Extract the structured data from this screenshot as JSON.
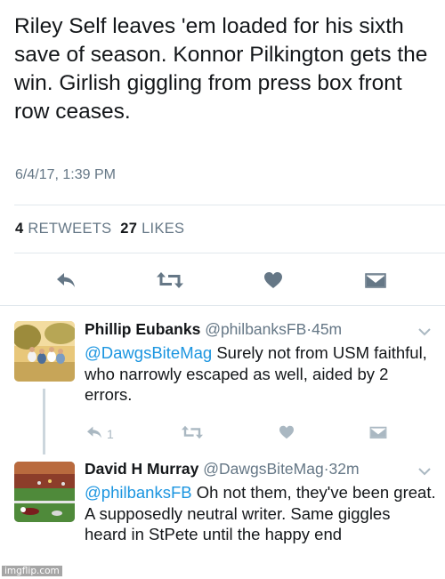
{
  "main_tweet": {
    "text": "Riley Self leaves 'em loaded for his sixth save of season. Konnor Pilkington gets the win. Girlish giggling from press box front row ceases.",
    "timestamp": "6/4/17, 1:39 PM",
    "retweets_count": "4",
    "retweets_label": "RETWEETS",
    "likes_count": "27",
    "likes_label": "LIKES"
  },
  "replies": [
    {
      "name": "Phillip Eubanks",
      "handle": "@philbanksFB",
      "dot": "·",
      "time": "45m",
      "mention": "@DawgsBiteMag",
      "text": " Surely not from USM faithful, who narrowly escaped as well, aided by 2 errors.",
      "reply_count": "1"
    },
    {
      "name": "David H Murray",
      "handle": "@DawgsBiteMag",
      "dot": "·",
      "time": "32m",
      "mention": "@philbanksFB",
      "text": " Oh not them, they've been great. A supposedly neutral writer. Same giggles heard in StPete until the happy end"
    }
  ],
  "icons": {
    "reply": "reply-icon",
    "retweet": "retweet-icon",
    "like": "heart-icon",
    "dm": "envelope-icon",
    "more": "chevron-down-icon"
  },
  "colors": {
    "action_dark": "#657786",
    "action_light": "#aab8c2",
    "link": "#1b95e0",
    "separator": "#e1e8ed"
  },
  "watermark": "imgflip.com"
}
